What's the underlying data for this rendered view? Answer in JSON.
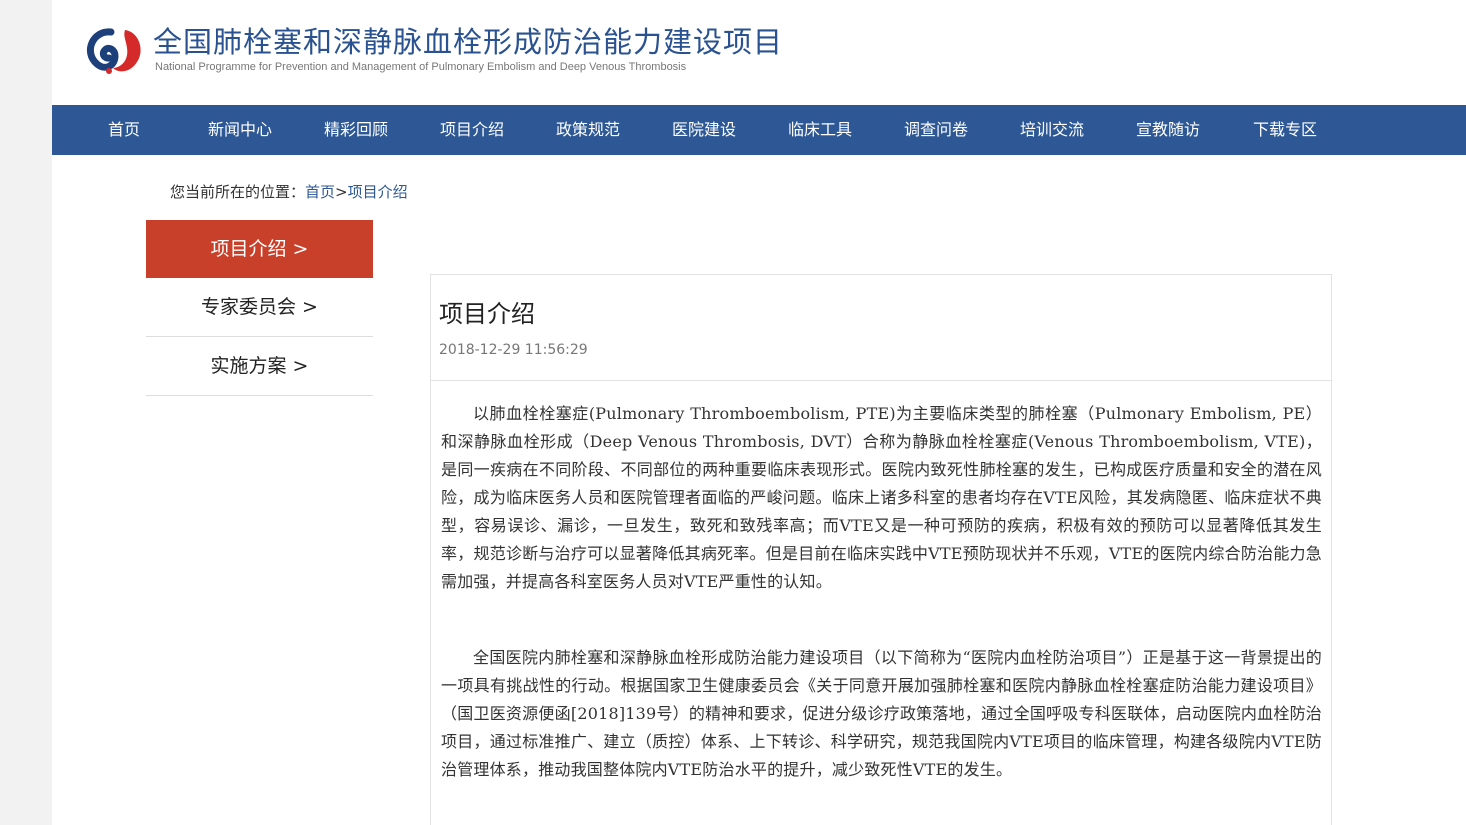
{
  "header": {
    "title": "全国肺栓塞和深静脉血栓形成防治能力建设项目",
    "subtitle": "National Programme for Prevention and Management of Pulmonary Embolism and Deep Venous Thrombosis",
    "logo_icon": "lung-drop-logo",
    "colors": {
      "brand_blue": "#2d5895",
      "brand_red": "#c8402a"
    }
  },
  "nav": {
    "items": [
      {
        "label": "首页"
      },
      {
        "label": "新闻中心"
      },
      {
        "label": "精彩回顾"
      },
      {
        "label": "项目介绍"
      },
      {
        "label": "政策规范"
      },
      {
        "label": "医院建设"
      },
      {
        "label": "临床工具"
      },
      {
        "label": "调查问卷"
      },
      {
        "label": "培训交流"
      },
      {
        "label": "宣教随访"
      },
      {
        "label": "下载专区"
      }
    ]
  },
  "breadcrumb": {
    "prefix": "您当前所在的位置：",
    "home": "首页",
    "separator": ">",
    "current": "项目介绍"
  },
  "sidebar": {
    "items": [
      {
        "label": "项目介绍 >",
        "active": true
      },
      {
        "label": "专家委员会 >",
        "active": false
      },
      {
        "label": "实施方案 >",
        "active": false
      }
    ]
  },
  "article": {
    "title": "项目介绍",
    "date": "2018-12-29 11:56:29",
    "paragraphs": [
      "以肺血栓栓塞症(Pulmonary Thromboembolism, PTE)为主要临床类型的肺栓塞（Pulmonary Embolism, PE）和深静脉血栓形成（Deep Venous Thrombosis, DVT）合称为静脉血栓栓塞症(Venous Thromboembolism, VTE)，是同一疾病在不同阶段、不同部位的两种重要临床表现形式。医院内致死性肺栓塞的发生，已构成医疗质量和安全的潜在风险，成为临床医务人员和医院管理者面临的严峻问题。临床上诸多科室的患者均存在VTE风险，其发病隐匿、临床症状不典型，容易误诊、漏诊，一旦发生，致死和致残率高；而VTE又是一种可预防的疾病，积极有效的预防可以显著降低其发生率，规范诊断与治疗可以显著降低其病死率。但是目前在临床实践中VTE预防现状并不乐观，VTE的医院内综合防治能力急需加强，并提高各科室医务人员对VTE严重性的认知。",
      "全国医院内肺栓塞和深静脉血栓形成防治能力建设项目（以下简称为“医院内血栓防治项目”）正是基于这一背景提出的一项具有挑战性的行动。根据国家卫生健康委员会《关于同意开展加强肺栓塞和医院内静脉血栓栓塞症防治能力建设项目》（国卫医资源便函[2018]139号）的精神和要求，促进分级诊疗政策落地，通过全国呼吸专科医联体，启动医院内血栓防治项目，通过标准推广、建立（质控）体系、上下转诊、科学研究，规范我国院内VTE项目的临床管理，构建各级院内VTE防治管理体系，推动我国整体院内VTE防治水平的提升，减少致死性VTE的发生。"
    ]
  }
}
